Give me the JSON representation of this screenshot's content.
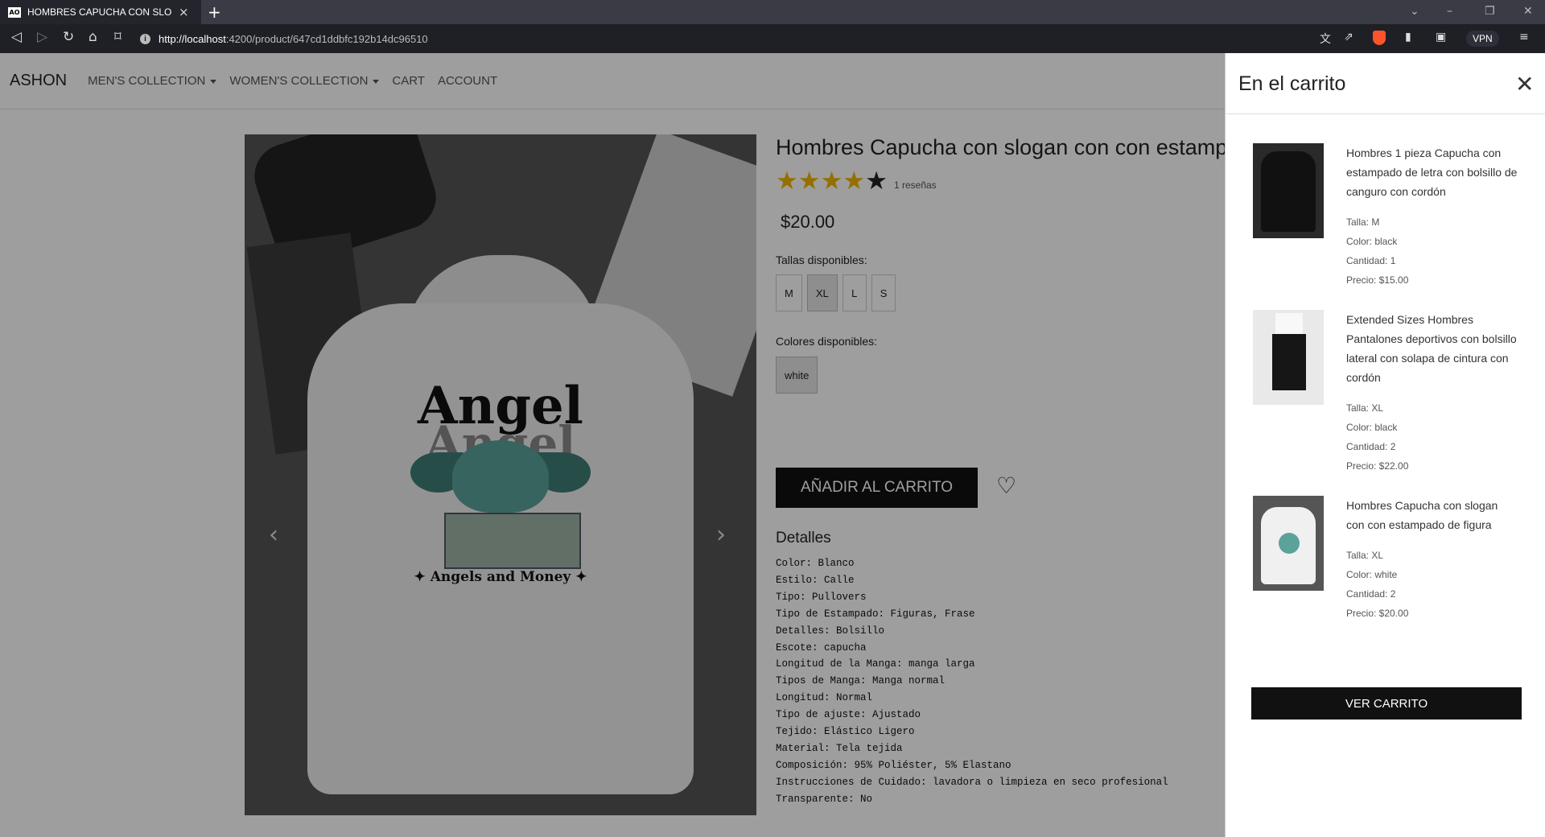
{
  "browser": {
    "tab_title": "HOMBRES CAPUCHA CON SLOG",
    "tab_favicon": "AO",
    "url_host": "http://localhost",
    "url_path": ":4200/product/647cd1ddbfc192b14dc96510",
    "vpn_label": "VPN"
  },
  "nav": {
    "brand": "ASHON",
    "links": [
      "MEN'S COLLECTION",
      "WOMEN'S COLLECTION",
      "CART",
      "ACCOUNT"
    ]
  },
  "product": {
    "title": "Hombres Capucha con slogan con con estampado de figura",
    "rating": 4,
    "reviews": "1 reseñas",
    "price": "$20.00",
    "sizes_label": "Tallas disponibles:",
    "sizes": [
      "M",
      "XL",
      "L",
      "S"
    ],
    "selected_size": "XL",
    "colors_label": "Colores disponibles:",
    "colors": [
      "white"
    ],
    "add_to_cart": "AÑADIR AL CARRITO",
    "details_title": "Detalles",
    "details": [
      "Color: Blanco",
      "Estilo: Calle",
      "Tipo: Pullovers",
      "Tipo de Estampado: Figuras, Frase",
      "Detalles: Bolsillo",
      "Escote: capucha",
      "Longitud de la Manga: manga larga",
      "Tipos de Manga: Manga normal",
      "Longitud: Normal",
      "Tipo de ajuste: Ajustado",
      "Tejido: Elástico Ligero",
      "Material: Tela tejida",
      "Composición: 95% Poliéster, 5% Elastano",
      "Instrucciones de Cuidado: lavadora o limpieza en seco profesional",
      "Transparente: No"
    ],
    "image_print": {
      "line1": "Angel",
      "line2": "Angel",
      "sub": "✦ Angels and Money ✦"
    }
  },
  "cart": {
    "title": "En el carrito",
    "button": "VER CARRITO",
    "items": [
      {
        "name": "Hombres 1 pieza Capucha con estampado de letra con bolsillo de canguro con cordón",
        "size": "Talla: M",
        "color": "Color: black",
        "qty": "Cantidad: 1",
        "price": "Precio: $15.00"
      },
      {
        "name": "Extended Sizes Hombres Pantalones deportivos con bolsillo lateral con solapa de cintura con cordón",
        "size": "Talla: XL",
        "color": "Color: black",
        "qty": "Cantidad: 2",
        "price": "Precio: $22.00"
      },
      {
        "name": "Hombres Capucha con slogan con con estampado de figura",
        "size": "Talla: XL",
        "color": "Color: white",
        "qty": "Cantidad: 2",
        "price": "Precio: $20.00"
      }
    ]
  },
  "colors": {
    "star": "#f0b400",
    "button_dark": "#111111",
    "brave_orange": "#fb542b"
  },
  "icons": {
    "back": "back-icon",
    "forward": "forward-icon",
    "reload": "reload-icon",
    "home": "home-icon",
    "bookmark": "bookmark-icon",
    "close": "close-icon",
    "heart": "heart-icon"
  }
}
